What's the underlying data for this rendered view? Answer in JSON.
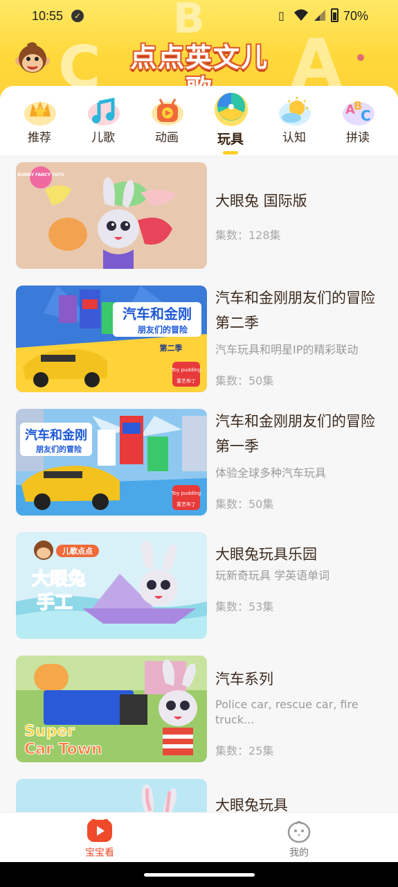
{
  "status_bar": {
    "time": "10:55",
    "battery": "70%"
  },
  "header": {
    "app_title": "点点英文儿歌",
    "accent_color": "#ffd83a"
  },
  "tabs": [
    {
      "label": "推荐",
      "icon": "crown-star-icon",
      "active": false
    },
    {
      "label": "儿歌",
      "icon": "music-note-icon",
      "active": false
    },
    {
      "label": "动画",
      "icon": "play-tv-icon",
      "active": false
    },
    {
      "label": "玩具",
      "icon": "beach-ball-icon",
      "active": true
    },
    {
      "label": "认知",
      "icon": "sun-cloud-icon",
      "active": false
    },
    {
      "label": "拼读",
      "icon": "abc-letters-icon",
      "active": false
    }
  ],
  "list": {
    "items": [
      {
        "title": "大眼兔 国际版",
        "desc": "",
        "episodes": "集数：128集",
        "thumb": "bunny-clay-toys"
      },
      {
        "title": "汽车和金刚朋友们的冒险第二季",
        "desc": "汽车玩具和明星IP的精彩联动",
        "episodes": "集数：50集",
        "thumb": "robot-car-s2"
      },
      {
        "title": "汽车和金刚朋友们的冒险 第一季",
        "desc": "体验全球多种汽车玩具",
        "episodes": "集数：50集",
        "thumb": "robot-car-s1"
      },
      {
        "title": "大眼兔玩具乐园",
        "desc": "玩新奇玩具 学英语单词",
        "episodes": "集数：53集",
        "thumb": "bunny-paper-boat"
      },
      {
        "title": "汽车系列",
        "desc": "Police car, rescue car, fire truck...",
        "episodes": "集数：25集",
        "thumb": "super-car-town"
      },
      {
        "title": "大眼兔玩具",
        "desc": "",
        "episodes": "",
        "thumb": "bunny-partial"
      }
    ],
    "thumb_texts": {
      "bunny_fancy_toys": "BUNNY FANCY TOYS",
      "robot_car_title_a": "汽车和金刚",
      "robot_car_title_b": "朋友们的冒险",
      "season2_badge": "第二季",
      "toy_pudding": "Toy pudding",
      "toy_pudding_cn": "童艺布丁",
      "erge_diandian": "儿歌点点",
      "bunny_craft_a": "大眼兔",
      "bunny_craft_b": "手工",
      "super": "Super",
      "car_town": "Car Town"
    }
  },
  "bottom_nav": [
    {
      "label": "宝宝看",
      "icon": "play-button-icon",
      "active": true
    },
    {
      "label": "我的",
      "icon": "chick-profile-icon",
      "active": false
    }
  ]
}
